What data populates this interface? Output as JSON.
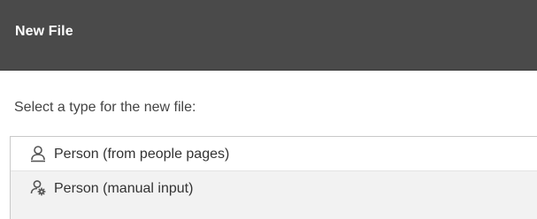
{
  "dialog": {
    "title": "New File",
    "prompt": "Select a type for the new file:",
    "file_types": [
      {
        "label": "Person (from people pages)",
        "icon": "person-icon"
      },
      {
        "label": "Person (manual input)",
        "icon": "person-gear-icon"
      }
    ]
  },
  "colors": {
    "titlebar_bg": "#4a4a4a",
    "title_text": "#ffffff",
    "body_text": "#444444",
    "selected_row_bg": "#f2f2f2"
  }
}
